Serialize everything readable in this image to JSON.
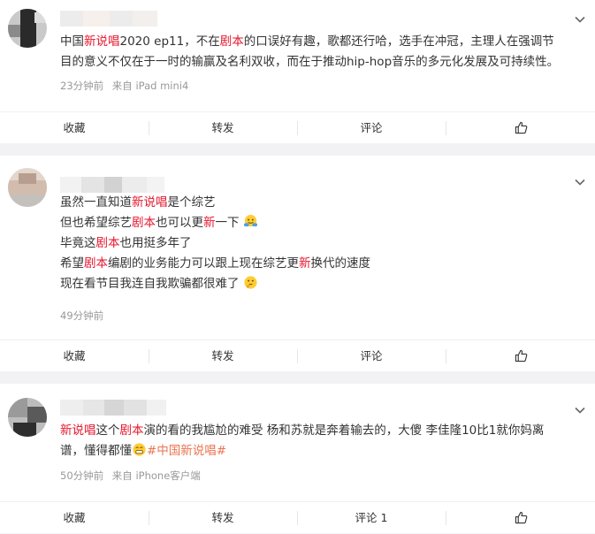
{
  "comments": [
    {
      "lines": [
        [
          {
            "t": "中国"
          },
          {
            "t": "新说唱",
            "c": "hl"
          },
          {
            "t": "2020 ep11，不在"
          },
          {
            "t": "剧本",
            "c": "hl"
          },
          {
            "t": "的口误好有趣，歌都还行哈，选手在冲冠，主理人在强调节"
          }
        ],
        [
          {
            "t": "目的意义不仅在于一时的输赢及名利双收，而在于推动hip-hop音乐的多元化发展及可持续性。"
          }
        ]
      ],
      "time": "23分钟前",
      "source": "来自 iPad mini4",
      "actions": {
        "favorite": "收藏",
        "repost": "转发",
        "comment": "评论"
      }
    },
    {
      "lines": [
        [
          {
            "t": "虽然一直知道"
          },
          {
            "t": "新说唱",
            "c": "hl"
          },
          {
            "t": "是个综艺"
          }
        ],
        [
          {
            "t": "但也希望综艺"
          },
          {
            "t": "剧本",
            "c": "hl"
          },
          {
            "t": "也可以更"
          },
          {
            "t": "新",
            "c": "hl"
          },
          {
            "t": "一下"
          }
        ],
        [
          {
            "t": "毕竟这"
          },
          {
            "t": "剧本",
            "c": "hl"
          },
          {
            "t": "也用挺多年了"
          }
        ],
        [
          {
            "t": "希望"
          },
          {
            "t": "剧本",
            "c": "hl"
          },
          {
            "t": "编剧的业务能力可以跟上现在综艺更"
          },
          {
            "t": "新",
            "c": "hl"
          },
          {
            "t": "换代的速度"
          }
        ],
        [
          {
            "t": "现在看节目我连自我欺骗都很难了"
          }
        ]
      ],
      "time": "49分钟前",
      "actions": {
        "favorite": "收藏",
        "repost": "转发",
        "comment": "评论"
      }
    },
    {
      "lines": [
        [
          {
            "t": "新说唱",
            "c": "hl"
          },
          {
            "t": "这个"
          },
          {
            "t": "剧本",
            "c": "hl"
          },
          {
            "t": "演的看的我尴尬的难受 杨和苏就是奔着输去的，大傻 李佳隆10比1就你妈离"
          }
        ],
        [
          {
            "t": "谱，懂得都懂"
          },
          {
            "t": "#中国新说唱#",
            "c": "tag"
          }
        ]
      ],
      "time": "50分钟前",
      "source": "来自 iPhone客户端",
      "actions": {
        "favorite": "收藏",
        "repost": "转发",
        "comment": "评论 1"
      }
    }
  ],
  "icons": {
    "more": "chevron-down-icon",
    "like": "thumbs-up-icon",
    "emoji_hug": "hug-emoji",
    "emoji_think": "thinking-emoji",
    "emoji_grin": "grin-emoji"
  },
  "colors": {
    "highlight": "#e6162d",
    "topic": "#eb7350",
    "meta": "#999999"
  }
}
